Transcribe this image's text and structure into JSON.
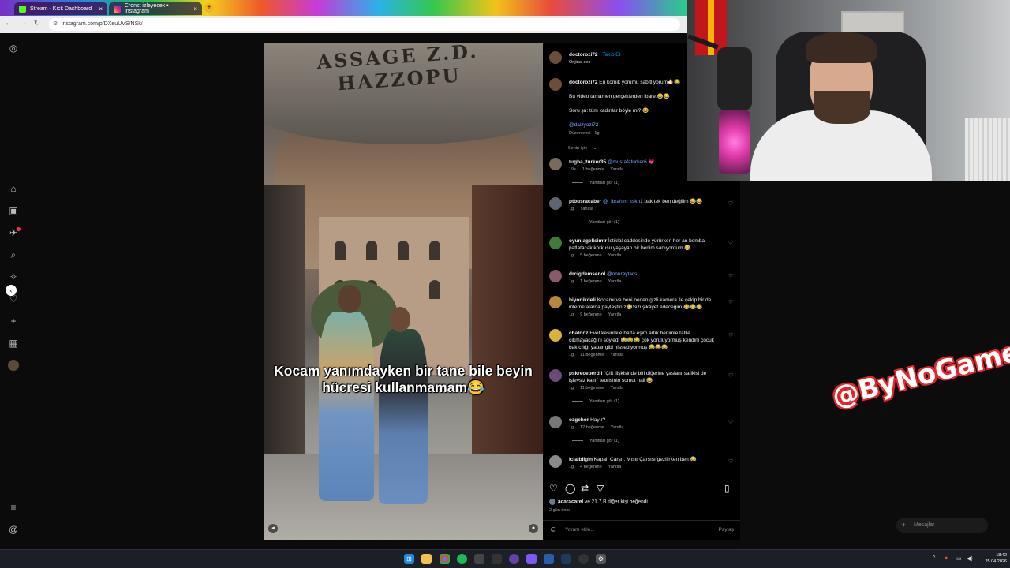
{
  "browser": {
    "tabs": [
      {
        "label": "Stream - Kick Dashboard"
      },
      {
        "label": "Cronst izleyecek • Instagram"
      }
    ],
    "url": "instagram.com/p/DXeuUVS/NSk/"
  },
  "video": {
    "sign_text": "ASSAGE Z.D. HAZZOPU",
    "caption": "Kocam yanımdayken bir tane bile beyin hücresi kullanmamam😂"
  },
  "post": {
    "author": "doctorozi72",
    "follow_label": "Takip Et",
    "audio": "Orijinal ses",
    "pinned_intro": "En komik yorumu sabitliyorum🤙🏻😂",
    "lines": [
      "Bu video tamamen gerçeklerden ibaret😂😂",
      "Soru şu: tüm kadınlar böyle mi? 😂"
    ],
    "tag": "@daizyozi72",
    "edited": "Düzenlendi · 1g",
    "sort": "Senin için"
  },
  "comments": [
    {
      "user": "tugba_turker35",
      "mention": "@mustafaturker6",
      "text": "💗",
      "meta": [
        "19s",
        "1 beğenme",
        "Yanıtla"
      ],
      "replies": "Yanıtları gör (1)",
      "color": "#7b6a5a"
    },
    {
      "user": "ptbusracaber",
      "mention": "@_ibrahim_tskn1",
      "text": "bak tek ben değilim 😂😂",
      "meta": [
        "1g",
        "Yanıtla"
      ],
      "replies": "Yanıtları gör (1)",
      "color": "#5b6670"
    },
    {
      "user": "oyunlagelisimtr",
      "mention": "",
      "text": "İstiklal caddesinde yürürken her an bomba patlatacak korkusu yaşayan bir benim sanıyordum 😂",
      "meta": [
        "1g",
        "5 beğenme",
        "Yanıtla"
      ],
      "replies": "",
      "color": "#3e7b3a"
    },
    {
      "user": "drcigdemsenol",
      "mention": "@onuraytacs",
      "text": "",
      "meta": [
        "1g",
        "1 beğenme",
        "Yanıtla"
      ],
      "replies": "",
      "color": "#8a5a6a"
    },
    {
      "user": "biyonikdeli",
      "mention": "",
      "text": "Kocamı ve beni neden gizli kamera ile çekip bir de internetalarda paylaştınız😂Sizi şikayet edeceğim 😂😂😂",
      "meta": [
        "1g",
        "9 beğenme",
        "Yanıtla"
      ],
      "replies": "",
      "color": "#b7863a"
    },
    {
      "user": "chatdnz",
      "mention": "",
      "text": "Evet kesinlikle hatta eşim artık benimle tatile çıkmayacağını söyledi 😂😂😂 çok yoruluyormuş kendini çocuk bakıcılığı yapar gibi hissediyormuş 😂😂😂",
      "meta": [
        "1g",
        "11 beğenme",
        "Yanıtla"
      ],
      "replies": "",
      "color": "#d9b23a"
    },
    {
      "user": "pskreceperdil",
      "mention": "",
      "text": "\"Çift ilişkisinde biri diğerine yaslanırsa ikisi de işlevsiz kalır\" teorisinin somut hali 😂",
      "meta": [
        "1g",
        "11 beğenme",
        "Yanıtla"
      ],
      "replies": "Yanıtları gör (1)",
      "color": "#6a4a7a"
    },
    {
      "user": "ozgehor",
      "mention": "",
      "text": "Hayır?",
      "meta": [
        "1g",
        "12 beğenme",
        "Yanıtla"
      ],
      "replies": "Yanıtları gör (1)",
      "color": "#777777"
    },
    {
      "user": "iclalbilgin",
      "mention": "",
      "text": "Kapalı Çarşı , Mısır Çarşısı gezilirken ben 😂",
      "meta": [
        "1g",
        "4 beğenme",
        "Yanıtla"
      ],
      "replies": "",
      "color": "#8a8a8a"
    }
  ],
  "likes": {
    "user": "acaracarel",
    "text": "ve 21.7 B diğer kişi beğendi"
  },
  "date": "2 gün önce",
  "composer": {
    "placeholder": "Yorum ekle...",
    "share": "Paylaş"
  },
  "overlay_logo": "@ByNoGame",
  "messages_label": "Mesajlar",
  "clock": {
    "time": "18:42",
    "date": "25.04.2026"
  },
  "colors": {
    "accent": "#0095f6",
    "mention": "#7aa7ff",
    "logo_red": "#e8262a"
  }
}
